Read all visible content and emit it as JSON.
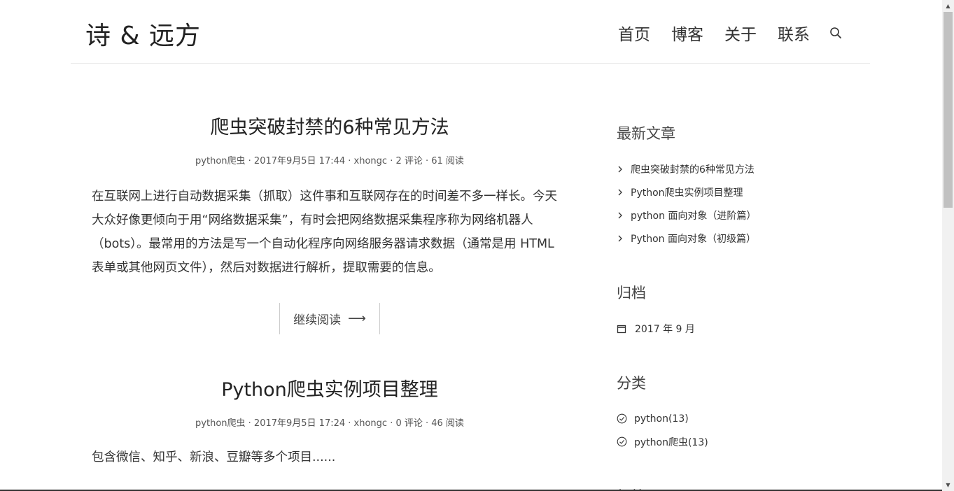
{
  "header": {
    "site_title": "诗 & 远方",
    "nav": [
      "首页",
      "博客",
      "关于",
      "联系"
    ],
    "search_icon": "search-icon"
  },
  "posts": [
    {
      "title": "爬虫突破封禁的6种常见方法",
      "meta": "python爬虫 · 2017年9月5日 17:44 · xhongc · 2 评论 · 61 阅读",
      "excerpt": "在互联网上进行自动数据采集（抓取）这件事和互联网存在的时间差不多一样长。今天大众好像更倾向于用“网络数据采集”，有时会把网络数据采集程序称为网络机器人（bots）。最常用的方法是写一个自动化程序向网络服务器请求数据（通常是用 HTML 表单或其他网页文件），然后对数据进行解析，提取需要的信息。",
      "read_more": "继续阅读"
    },
    {
      "title": "Python爬虫实例项目整理",
      "meta": "python爬虫 · 2017年9月5日 17:24 · xhongc · 0 评论 · 46 阅读",
      "excerpt": "包含微信、知乎、新浪、豆瓣等多个项目......"
    }
  ],
  "sidebar": {
    "recent": {
      "title": "最新文章",
      "items": [
        "爬虫突破封禁的6种常见方法",
        "Python爬虫实例项目整理",
        "python 面向对象（进阶篇）",
        "Python 面向对象（初级篇）"
      ]
    },
    "archive": {
      "title": "归档",
      "items": [
        "2017 年 9 月"
      ]
    },
    "categories": {
      "title": "分类",
      "items": [
        "python(13)",
        "python爬虫(13)"
      ]
    },
    "tags": {
      "title": "标签云"
    }
  }
}
